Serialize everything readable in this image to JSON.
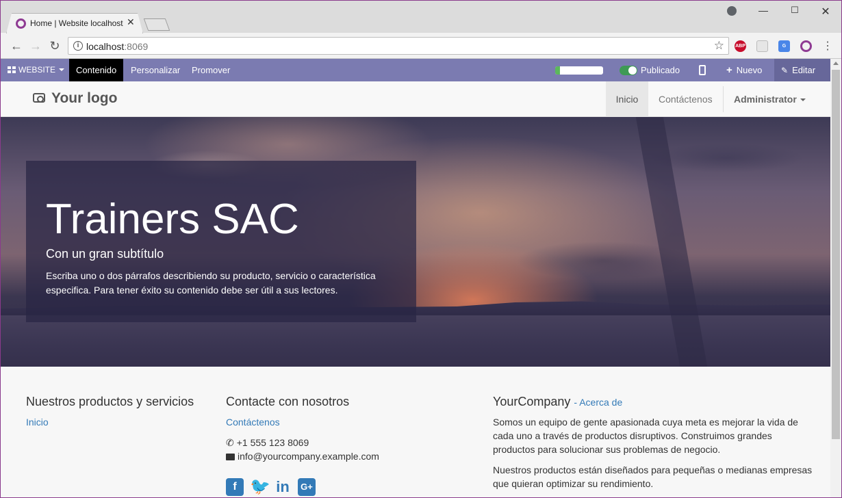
{
  "browser": {
    "tab_title": "Home | Website localhost",
    "url_host": "localhost",
    "url_port": ":8069"
  },
  "toolbar": {
    "website_label": "WEBSITE",
    "items": [
      "Contenido",
      "Personalizar",
      "Promover"
    ],
    "active_item": "Contenido",
    "published_label": "Publicado",
    "progress_fraction": 0.1,
    "new_label": "Nuevo",
    "edit_label": "Editar",
    "accent_color": "#7b7bb1"
  },
  "site": {
    "logo_text": "Your logo",
    "menu": {
      "home": "Inicio",
      "contact": "Contáctenos",
      "user": "Administrator"
    }
  },
  "hero": {
    "title": "Trainers SAC",
    "subtitle": "Con un gran subtítulo",
    "text": "Escriba uno o dos párrafos describiendo su producto, servicio o característica especifica. Para tener éxito su contenido debe ser útil a sus lectores."
  },
  "footer": {
    "products_heading": "Nuestros productos y servicios",
    "products_link": "Inicio",
    "contact_heading": "Contacte con nosotros",
    "contact_link": "Contáctenos",
    "phone": "+1 555 123 8069",
    "email": "info@yourcompany.example.com",
    "company_name": "YourCompany",
    "about_link": "- Acerca de",
    "about_text_1": "Somos un equipo de gente apasionada cuya meta es mejorar la vida de cada uno a través de productos disruptivos. Construimos grandes productos para solucionar sus problemas de negocio.",
    "about_text_2": "Nuestros productos están diseñados para pequeñas o medianas empresas que quieran optimizar su rendimiento.",
    "social_icons": [
      "facebook-icon",
      "twitter-icon",
      "linkedin-icon",
      "google-plus-icon"
    ]
  }
}
